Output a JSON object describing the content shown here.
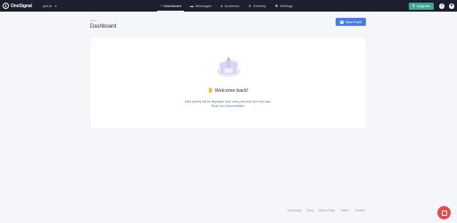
{
  "topbar": {
    "brand": "OneSignal",
    "app_name": "pixi.io",
    "nav": [
      {
        "label": "Dashboard",
        "icon": "dashboard-icon",
        "active": true
      },
      {
        "label": "Messages",
        "icon": "chat-icon",
        "active": false
      },
      {
        "label": "Audience",
        "icon": "users-icon",
        "active": false
      },
      {
        "label": "Delivery",
        "icon": "send-icon",
        "active": false
      },
      {
        "label": "Settings",
        "icon": "gear-icon",
        "active": false
      }
    ],
    "upgrade_label": "Upgrade",
    "help_glyph": "?"
  },
  "header": {
    "breadcrumb": "pixi.io",
    "title": "Dashboard",
    "new_push_label": "New Push"
  },
  "main": {
    "welcome": "Welcome back!",
    "activity_note": "User activity will be displayed here once you have your first user.",
    "docs_link": "Read our documentation"
  },
  "footer": {
    "links": [
      "Homepage",
      "Blog",
      "Status Page",
      "Twitter",
      "Contact"
    ]
  },
  "colors": {
    "topbar": "#1b1f2e",
    "accent": "#4a7be8",
    "upgrade": "#3fa796",
    "chat": "#e54b4d"
  }
}
